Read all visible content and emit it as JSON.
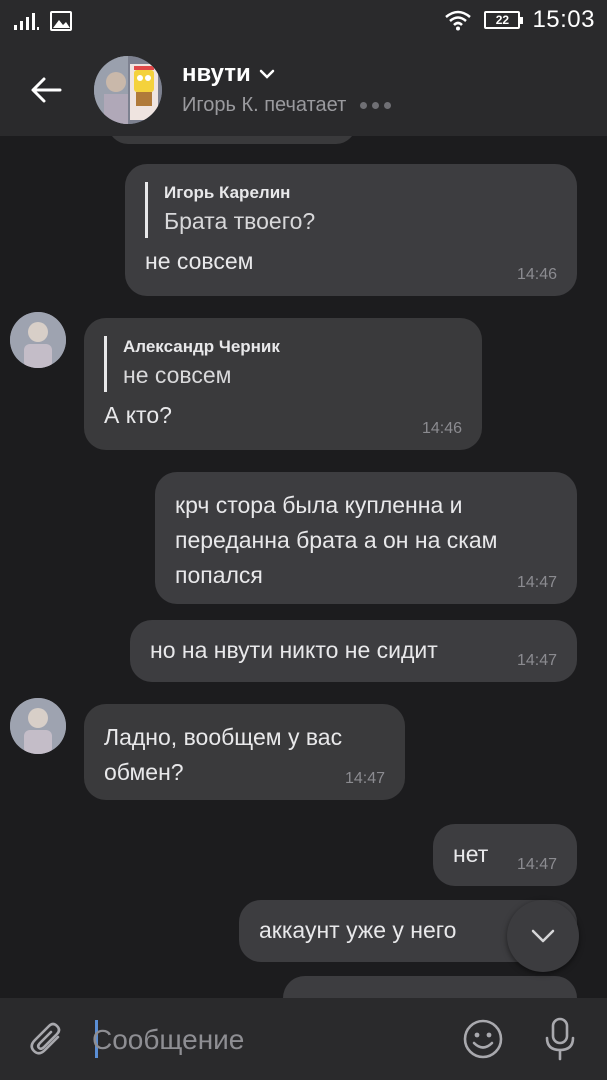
{
  "status_bar": {
    "time": "15:03",
    "battery": "22"
  },
  "header": {
    "title": "нвути",
    "subtitle": "Игорь К. печатает"
  },
  "messages": [
    {
      "reply_name": "Игорь Карелин",
      "reply_text": "Брата твоего?",
      "text": "не совсем",
      "time": "14:46"
    },
    {
      "reply_name": "Александр Черник",
      "reply_text": "не совсем",
      "text": "А кто?",
      "time": "14:46"
    },
    {
      "text": "крч стора была купленна и переданна брата а он на скам попался",
      "time": "14:47"
    },
    {
      "text": "но на нвути никто не сидит",
      "time": "14:47"
    },
    {
      "text": "Ладно, вообщем у вас обмен?",
      "time": "14:47"
    },
    {
      "text": "нет",
      "time": "14:47"
    },
    {
      "text": "аккаунт уже у него",
      "time": ""
    }
  ],
  "input": {
    "placeholder": "Сообщение",
    "value": ""
  },
  "icons": {
    "back": "arrow-left-icon",
    "chevron": "chevron-down-icon",
    "attach": "paperclip-icon",
    "emoji": "smiley-icon",
    "mic": "microphone-icon",
    "scroll": "chevron-down-icon"
  },
  "colors": {
    "background": "#1c1c1e",
    "bubble": "#3a3a3c",
    "bar": "#2a2a2c",
    "caret": "#5b8fd6"
  }
}
